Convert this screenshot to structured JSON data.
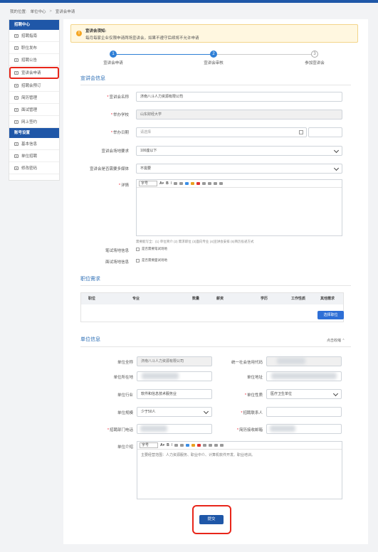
{
  "breadcrumb": {
    "items": [
      "我的位置:",
      "单位中心",
      "宣讲会申请"
    ],
    "sep": ">"
  },
  "sidebar": {
    "sections": [
      {
        "title": "招聘中心",
        "items": [
          "招聘指南",
          "职位发布",
          "招聘公告",
          "宣讲会申请",
          "招聘会预订",
          "简历管理",
          "面试管理",
          "网上签约"
        ]
      },
      {
        "title": "账号设置",
        "items": [
          "基本信息",
          "单位招聘",
          "修改密码"
        ]
      }
    ]
  },
  "notice": {
    "icon": "!",
    "title": "宣讲会须知:",
    "text": "每月每家企业仅限申请两场宣讲会，如果不遵守后续将不允许申请"
  },
  "steps": [
    {
      "num": "1",
      "label": "宣讲会申请",
      "state": "done"
    },
    {
      "num": "2",
      "label": "宣讲会审核",
      "state": "done"
    },
    {
      "num": "3",
      "label": "参加宣讲会",
      "state": "todo"
    }
  ],
  "seminar": {
    "title": "宣讲会信息",
    "name_label": "宣讲会名称",
    "name_value": "济南八斗人力资源有限公司",
    "school_label": "举办学校",
    "school_value": "山东财经大学",
    "date_label": "举办日期",
    "date_placeholder": "请选择",
    "scale_label": "宣讲会场地要求",
    "scale_value": "100座以下",
    "media_label": "宣讲会是否需要多媒体",
    "media_value": "不需要",
    "detail_label": "详情",
    "font_label": "字号",
    "hint": "需要能写全：(1) 单位简介 (2) 需求职位 (3)面向专业 (4)宣讲会安排 (5)简历投递方式",
    "written_label": "笔试场地信息",
    "written_check": "是否需要笔试场地",
    "interview_label": "面试场地信息",
    "interview_check": "是否需要面试场地"
  },
  "positions": {
    "title": "职位需求",
    "columns": [
      "职位",
      "专业",
      "数量",
      "薪资",
      "学历",
      "工作性质",
      "其他需求"
    ],
    "select_button": "选择职位"
  },
  "company": {
    "title": "单位信息",
    "collapse": "点击收缩",
    "fields": [
      {
        "label": "单位全称",
        "value": "济南八斗人力资源有限公司",
        "required": false,
        "disabled": true
      },
      {
        "label": "统一社会信用代码",
        "value": "",
        "required": false,
        "disabled": true
      },
      {
        "label": "单位所在地",
        "value": "",
        "required": false,
        "disabled": false
      },
      {
        "label": "单位地址",
        "value": "",
        "required": false,
        "disabled": false
      },
      {
        "label": "单位行业",
        "value": "软件和信息技术服务业",
        "required": false,
        "disabled": false
      },
      {
        "label": "单位性质",
        "value": "医疗卫生单位",
        "required": true,
        "disabled": false
      },
      {
        "label": "单位规模",
        "value": "少于50人",
        "required": false,
        "disabled": false
      },
      {
        "label": "招聘联系人",
        "value": "",
        "required": true,
        "disabled": false
      },
      {
        "label": "招聘部门电话",
        "value": "",
        "required": true,
        "disabled": false
      },
      {
        "label": "简历接收邮箱",
        "value": "",
        "required": true,
        "disabled": false
      }
    ],
    "intro_label": "单位介绍",
    "intro_text": "主要经营范围：人力资源服务、职业中介、计算机软件开发、职业培训。"
  },
  "submit_label": "提交",
  "colors": {
    "primary": "#1f57a8",
    "accent": "#2e7fd6",
    "highlight": "#e8261a",
    "notice_bg": "#fff7e0"
  }
}
